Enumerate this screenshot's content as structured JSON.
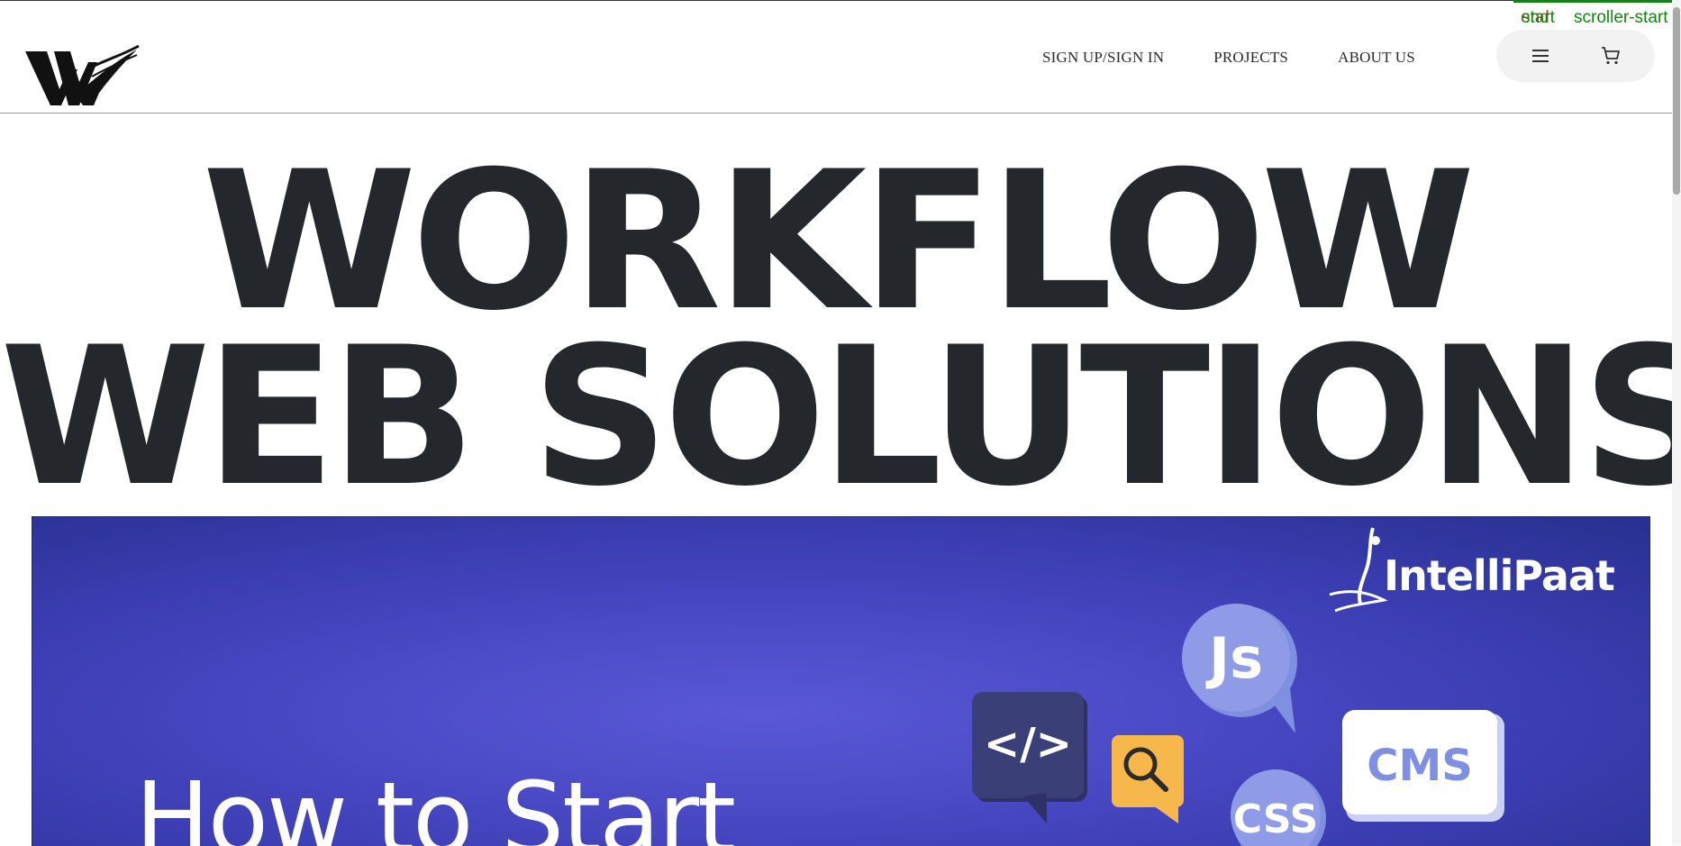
{
  "debug": {
    "end": "end",
    "start1": "start",
    "start2": "scroller-start"
  },
  "nav": [
    {
      "label": "SIGN UP/SIGN IN"
    },
    {
      "label": "PROJECTS"
    },
    {
      "label": "ABOUT US"
    }
  ],
  "icons": {
    "menu": "hamburger-menu-icon",
    "cart": "shopping-cart-icon",
    "logo": "workflow-logo"
  },
  "headline": {
    "line1": "WORKFLOW",
    "line2": "WEB SOLUTIONS"
  },
  "hero": {
    "brand": "IntelliPaat",
    "badges": {
      "code": "</>",
      "js": "Js",
      "css": "CSS",
      "cms": "CMS"
    },
    "title": "How to Start"
  },
  "colors": {
    "headline": "#24272b",
    "hero_blue": "#4a49c6",
    "badge_light": "#8f9be6",
    "badge_dark": "#3a3f78",
    "search_yellow": "#f6b84a"
  }
}
